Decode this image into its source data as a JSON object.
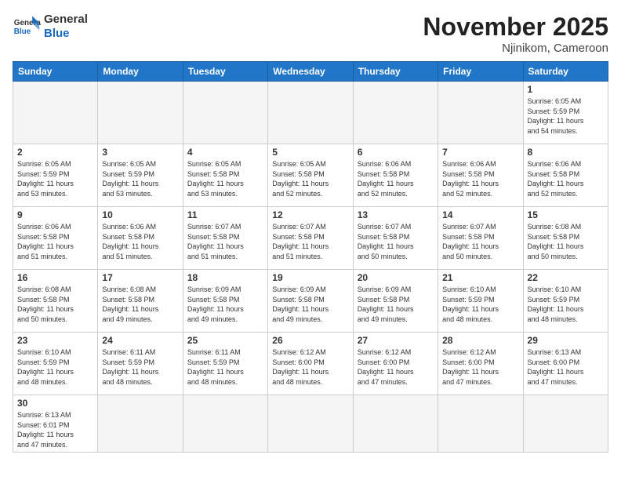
{
  "header": {
    "logo_general": "General",
    "logo_blue": "Blue",
    "month_title": "November 2025",
    "location": "Njinikom, Cameroon"
  },
  "weekdays": [
    "Sunday",
    "Monday",
    "Tuesday",
    "Wednesday",
    "Thursday",
    "Friday",
    "Saturday"
  ],
  "weeks": [
    [
      {
        "day": "",
        "info": ""
      },
      {
        "day": "",
        "info": ""
      },
      {
        "day": "",
        "info": ""
      },
      {
        "day": "",
        "info": ""
      },
      {
        "day": "",
        "info": ""
      },
      {
        "day": "",
        "info": ""
      },
      {
        "day": "1",
        "info": "Sunrise: 6:05 AM\nSunset: 5:59 PM\nDaylight: 11 hours\nand 54 minutes."
      }
    ],
    [
      {
        "day": "2",
        "info": "Sunrise: 6:05 AM\nSunset: 5:59 PM\nDaylight: 11 hours\nand 53 minutes."
      },
      {
        "day": "3",
        "info": "Sunrise: 6:05 AM\nSunset: 5:59 PM\nDaylight: 11 hours\nand 53 minutes."
      },
      {
        "day": "4",
        "info": "Sunrise: 6:05 AM\nSunset: 5:58 PM\nDaylight: 11 hours\nand 53 minutes."
      },
      {
        "day": "5",
        "info": "Sunrise: 6:05 AM\nSunset: 5:58 PM\nDaylight: 11 hours\nand 52 minutes."
      },
      {
        "day": "6",
        "info": "Sunrise: 6:06 AM\nSunset: 5:58 PM\nDaylight: 11 hours\nand 52 minutes."
      },
      {
        "day": "7",
        "info": "Sunrise: 6:06 AM\nSunset: 5:58 PM\nDaylight: 11 hours\nand 52 minutes."
      },
      {
        "day": "8",
        "info": "Sunrise: 6:06 AM\nSunset: 5:58 PM\nDaylight: 11 hours\nand 52 minutes."
      }
    ],
    [
      {
        "day": "9",
        "info": "Sunrise: 6:06 AM\nSunset: 5:58 PM\nDaylight: 11 hours\nand 51 minutes."
      },
      {
        "day": "10",
        "info": "Sunrise: 6:06 AM\nSunset: 5:58 PM\nDaylight: 11 hours\nand 51 minutes."
      },
      {
        "day": "11",
        "info": "Sunrise: 6:07 AM\nSunset: 5:58 PM\nDaylight: 11 hours\nand 51 minutes."
      },
      {
        "day": "12",
        "info": "Sunrise: 6:07 AM\nSunset: 5:58 PM\nDaylight: 11 hours\nand 51 minutes."
      },
      {
        "day": "13",
        "info": "Sunrise: 6:07 AM\nSunset: 5:58 PM\nDaylight: 11 hours\nand 50 minutes."
      },
      {
        "day": "14",
        "info": "Sunrise: 6:07 AM\nSunset: 5:58 PM\nDaylight: 11 hours\nand 50 minutes."
      },
      {
        "day": "15",
        "info": "Sunrise: 6:08 AM\nSunset: 5:58 PM\nDaylight: 11 hours\nand 50 minutes."
      }
    ],
    [
      {
        "day": "16",
        "info": "Sunrise: 6:08 AM\nSunset: 5:58 PM\nDaylight: 11 hours\nand 50 minutes."
      },
      {
        "day": "17",
        "info": "Sunrise: 6:08 AM\nSunset: 5:58 PM\nDaylight: 11 hours\nand 49 minutes."
      },
      {
        "day": "18",
        "info": "Sunrise: 6:09 AM\nSunset: 5:58 PM\nDaylight: 11 hours\nand 49 minutes."
      },
      {
        "day": "19",
        "info": "Sunrise: 6:09 AM\nSunset: 5:58 PM\nDaylight: 11 hours\nand 49 minutes."
      },
      {
        "day": "20",
        "info": "Sunrise: 6:09 AM\nSunset: 5:58 PM\nDaylight: 11 hours\nand 49 minutes."
      },
      {
        "day": "21",
        "info": "Sunrise: 6:10 AM\nSunset: 5:59 PM\nDaylight: 11 hours\nand 48 minutes."
      },
      {
        "day": "22",
        "info": "Sunrise: 6:10 AM\nSunset: 5:59 PM\nDaylight: 11 hours\nand 48 minutes."
      }
    ],
    [
      {
        "day": "23",
        "info": "Sunrise: 6:10 AM\nSunset: 5:59 PM\nDaylight: 11 hours\nand 48 minutes."
      },
      {
        "day": "24",
        "info": "Sunrise: 6:11 AM\nSunset: 5:59 PM\nDaylight: 11 hours\nand 48 minutes."
      },
      {
        "day": "25",
        "info": "Sunrise: 6:11 AM\nSunset: 5:59 PM\nDaylight: 11 hours\nand 48 minutes."
      },
      {
        "day": "26",
        "info": "Sunrise: 6:12 AM\nSunset: 6:00 PM\nDaylight: 11 hours\nand 48 minutes."
      },
      {
        "day": "27",
        "info": "Sunrise: 6:12 AM\nSunset: 6:00 PM\nDaylight: 11 hours\nand 47 minutes."
      },
      {
        "day": "28",
        "info": "Sunrise: 6:12 AM\nSunset: 6:00 PM\nDaylight: 11 hours\nand 47 minutes."
      },
      {
        "day": "29",
        "info": "Sunrise: 6:13 AM\nSunset: 6:00 PM\nDaylight: 11 hours\nand 47 minutes."
      }
    ],
    [
      {
        "day": "30",
        "info": "Sunrise: 6:13 AM\nSunset: 6:01 PM\nDaylight: 11 hours\nand 47 minutes."
      },
      {
        "day": "",
        "info": ""
      },
      {
        "day": "",
        "info": ""
      },
      {
        "day": "",
        "info": ""
      },
      {
        "day": "",
        "info": ""
      },
      {
        "day": "",
        "info": ""
      },
      {
        "day": "",
        "info": ""
      }
    ]
  ]
}
